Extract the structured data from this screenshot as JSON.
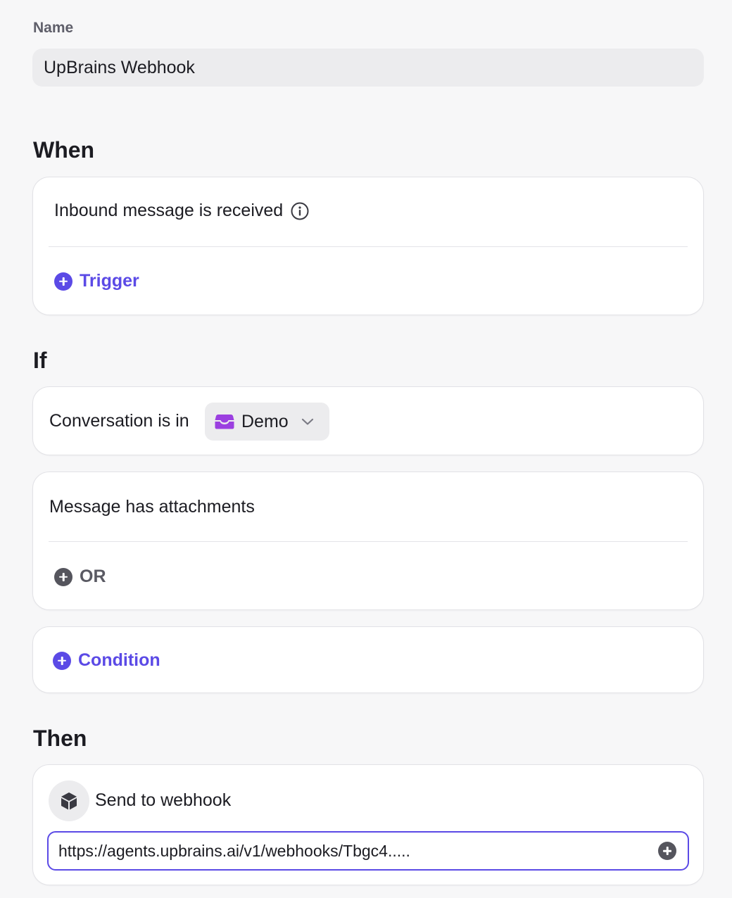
{
  "name_field": {
    "label": "Name",
    "value": "UpBrains Webhook"
  },
  "when": {
    "title": "When",
    "trigger_text": "Inbound message is received",
    "add_trigger_label": "Trigger"
  },
  "if": {
    "title": "If",
    "condition_1": {
      "text": "Conversation is in",
      "inbox_value": "Demo",
      "inbox_icon_color": "#9b3fe0"
    },
    "condition_2": {
      "text": "Message has attachments",
      "or_label": "OR"
    },
    "add_condition_label": "Condition"
  },
  "then": {
    "title": "Then",
    "action_label": "Send to webhook",
    "url_value": "https://agents.upbrains.ai/v1/webhooks/Tbgc4....."
  },
  "colors": {
    "accent": "#5b4ae6",
    "background": "#f7f7f8",
    "card": "#ffffff",
    "input_bg": "#ececee"
  }
}
